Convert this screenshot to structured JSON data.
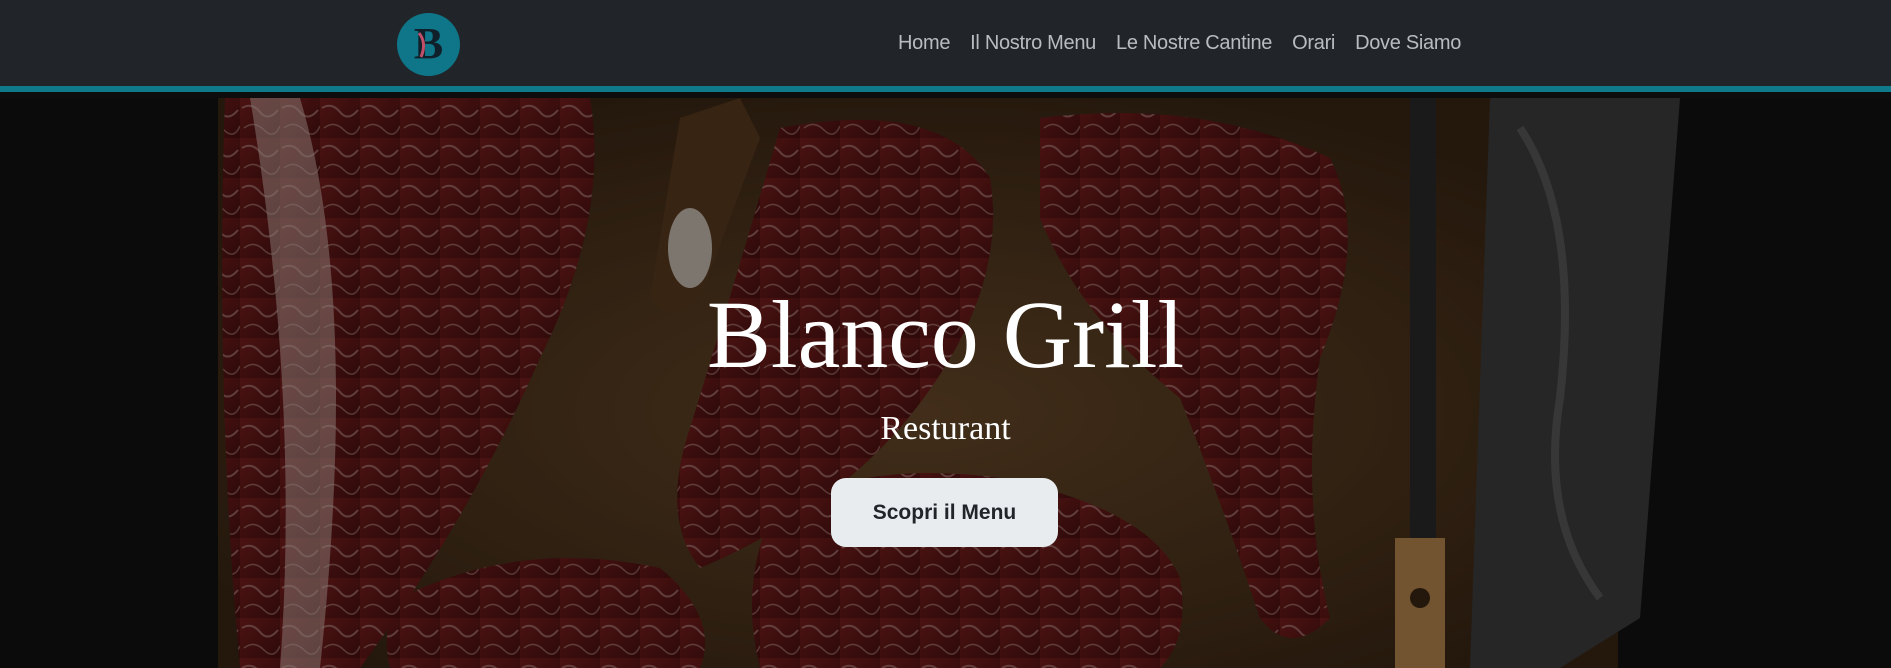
{
  "brand": {
    "logo_letter": "B",
    "logo_color": "#0e7688"
  },
  "nav": {
    "items": [
      {
        "label": "Home"
      },
      {
        "label": "Il Nostro Menu"
      },
      {
        "label": "Le Nostre Cantine"
      },
      {
        "label": "Orari"
      },
      {
        "label": "Dove Siamo"
      }
    ]
  },
  "hero": {
    "title": "Blanco Grill",
    "subtitle": "Resturant",
    "cta_label": "Scopri il Menu"
  },
  "colors": {
    "navbar_bg": "#212529",
    "accent": "#0e7a8a",
    "button_bg": "#e9ecef"
  }
}
